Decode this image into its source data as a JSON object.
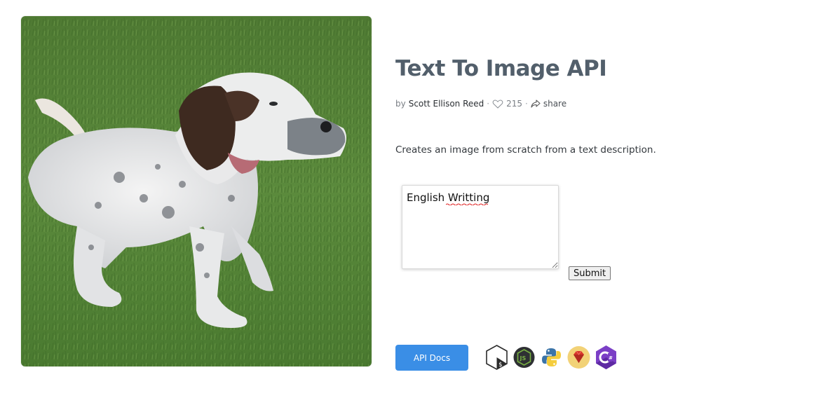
{
  "page": {
    "title": "Text To Image API",
    "description": "Creates an image from scratch from a text description."
  },
  "meta": {
    "by_label": "by",
    "author": "Scott Ellison Reed",
    "likes": "215",
    "share_label": "share"
  },
  "form": {
    "prompt_value": "English Writting",
    "submit_label": "Submit"
  },
  "footer": {
    "api_docs_label": "API Docs",
    "language_icons": [
      "shell-icon",
      "nodejs-icon",
      "python-icon",
      "ruby-icon",
      "csharp-icon"
    ]
  },
  "colors": {
    "title": "#525f6b",
    "api_button": "#3a8ee6"
  },
  "image": {
    "subject": "dog-on-grass-image"
  }
}
